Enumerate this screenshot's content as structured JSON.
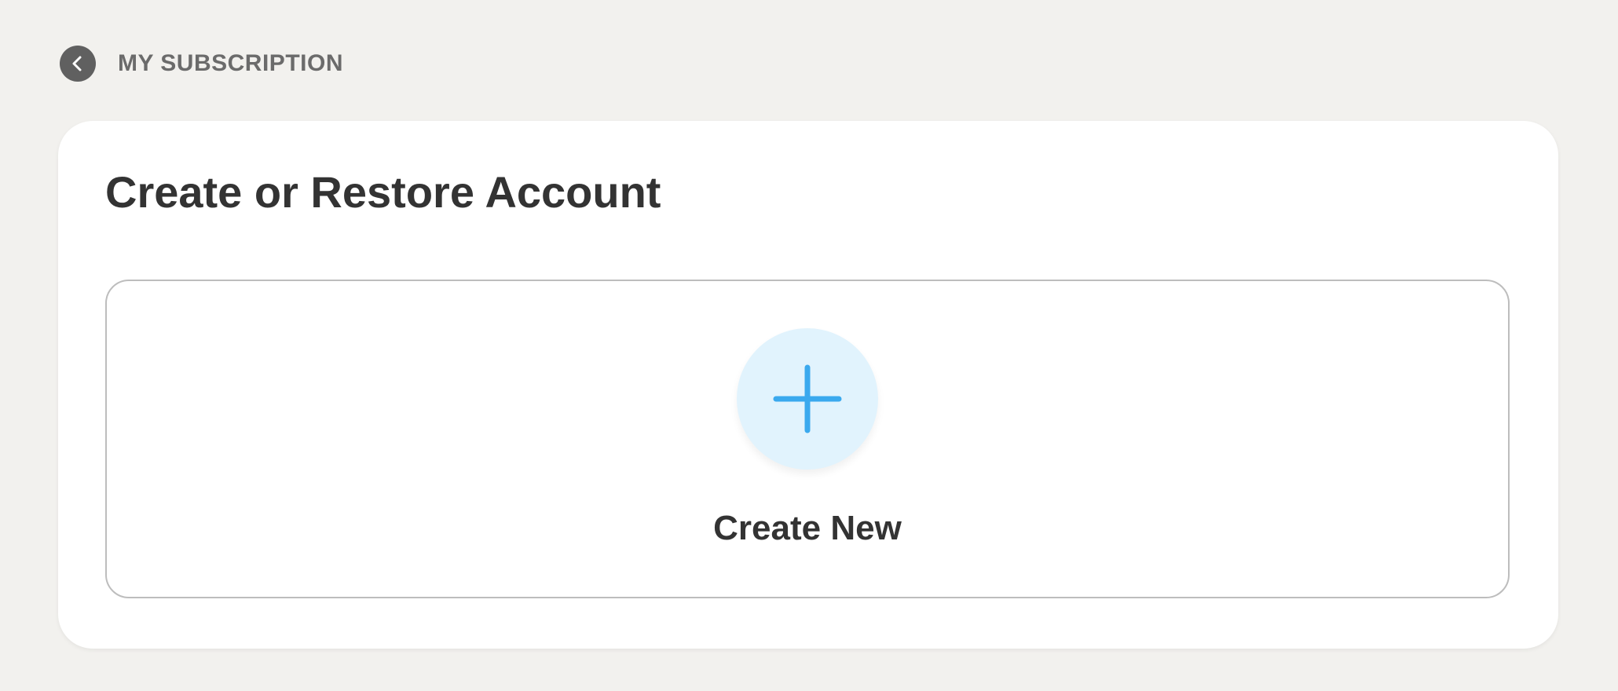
{
  "header": {
    "title": "MY SUBSCRIPTION",
    "back_icon": "chevron-left-icon"
  },
  "card": {
    "title": "Create or Restore Account",
    "create_option": {
      "label": "Create New",
      "icon": "plus-icon"
    }
  },
  "colors": {
    "background": "#f2f1ee",
    "card": "#ffffff",
    "back_button": "#606060",
    "accent": "#3aa9ee",
    "plus_circle": "#e1f3fd",
    "text_primary": "#333333",
    "text_secondary": "#6b6b6b"
  }
}
